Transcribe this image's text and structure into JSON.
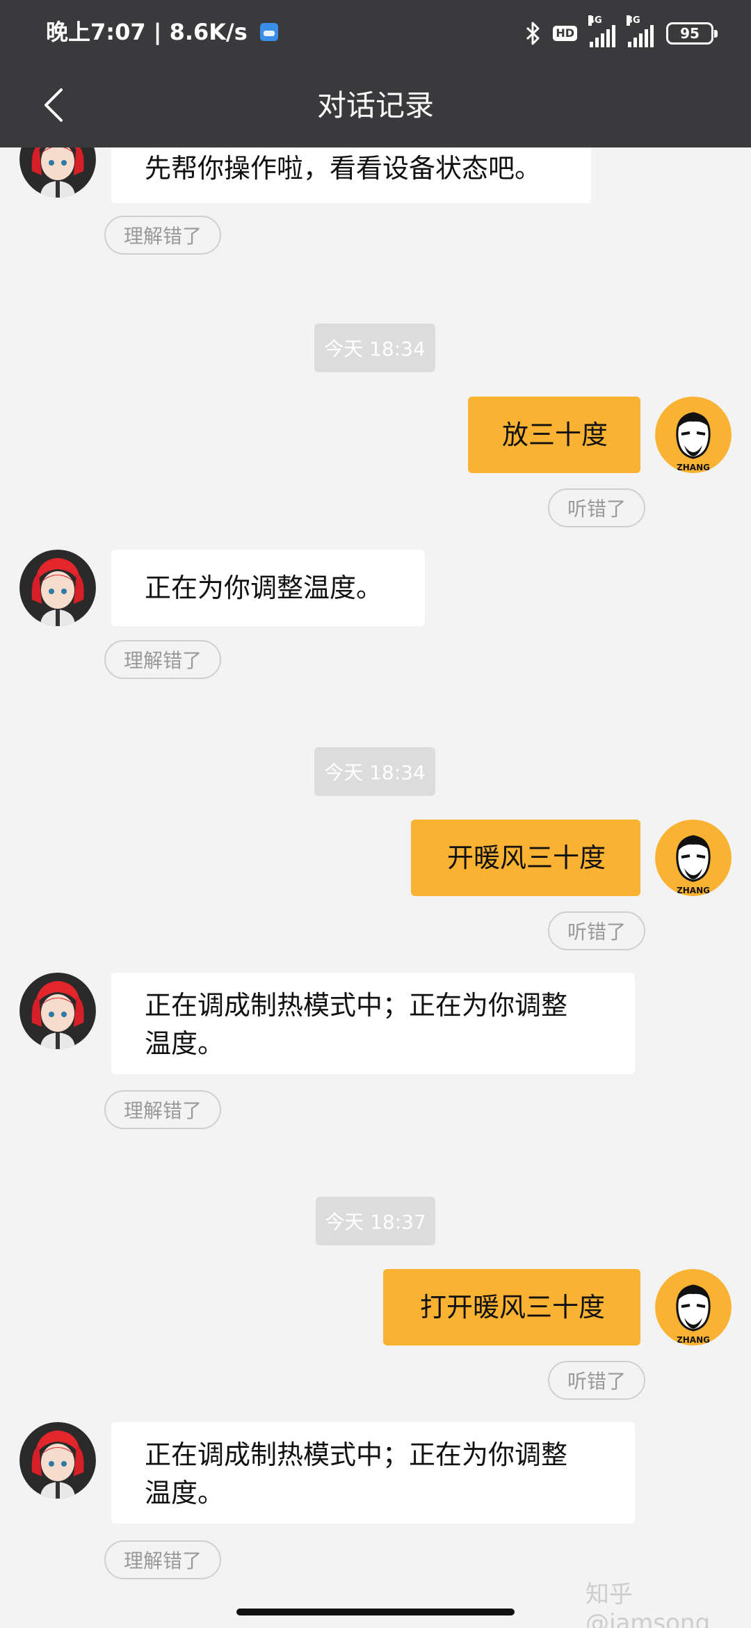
{
  "status_bar": {
    "time_speed": "晚上7:07 | 8.6K/s",
    "hd": "HD",
    "net1": "4G",
    "net2": "3G",
    "battery": "95"
  },
  "header": {
    "title": "对话记录"
  },
  "messages": {
    "m0": {
      "bot_text": "先帮你操作啦，看看设备状态吧。",
      "feedback": "理解错了"
    },
    "m1": {
      "time": "今天 18:34",
      "user_text": "放三十度",
      "user_feedback": "听错了",
      "bot_text": "正在为你调整温度。",
      "bot_feedback": "理解错了"
    },
    "m2": {
      "time": "今天 18:34",
      "user_text": "开暖风三十度",
      "user_feedback": "听错了",
      "bot_line1": "正在调成制热模式中；正在为你调整",
      "bot_line2": "温度。",
      "bot_feedback": "理解错了"
    },
    "m3": {
      "time": "今天 18:37",
      "user_text": "打开暖风三十度",
      "user_feedback": "听错了",
      "bot_line1": "正在调成制热模式中；正在为你调整",
      "bot_line2": "温度。",
      "bot_feedback": "理解错了"
    }
  },
  "watermark": "知乎 @iamsong",
  "colors": {
    "bar": "#3a3a3c",
    "user_bubble": "#f9b232",
    "background": "#f3f3f3"
  },
  "user_avatar_text": "ZHANG"
}
